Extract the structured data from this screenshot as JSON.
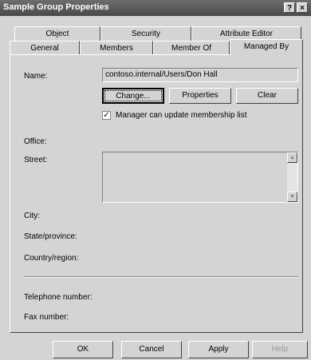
{
  "window": {
    "title": "Sample Group Properties",
    "help_btn": "?",
    "close_btn": "×"
  },
  "tabs_row1": [
    "Object",
    "Security",
    "Attribute Editor"
  ],
  "tabs_row2": [
    "General",
    "Members",
    "Member Of",
    "Managed By"
  ],
  "form": {
    "name_label": "Name:",
    "name_value": "contoso.internal/Users/Don Hall",
    "change_btn": "Change...",
    "properties_btn": "Properties",
    "clear_btn": "Clear",
    "manager_checkbox_label": "Manager can update membership list",
    "manager_checkbox_checked": true,
    "office_label": "Office:",
    "street_label": "Street:",
    "city_label": "City:",
    "state_label": "State/province:",
    "country_label": "Country/region:",
    "telephone_label": "Telephone number:",
    "fax_label": "Fax number:"
  },
  "footer": {
    "ok": "OK",
    "cancel": "Cancel",
    "apply": "Apply",
    "help": "Help"
  }
}
